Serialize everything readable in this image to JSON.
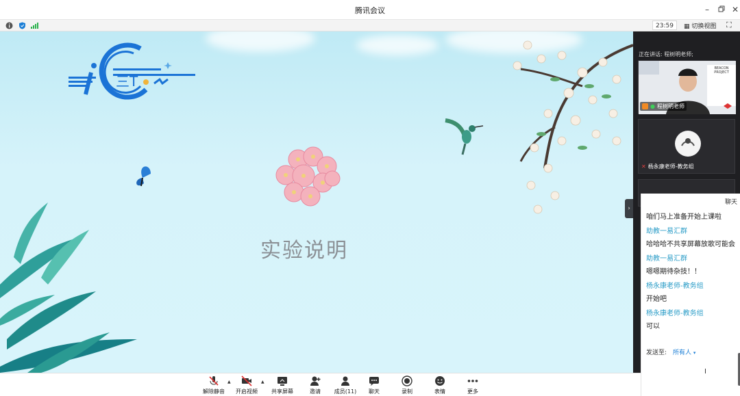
{
  "window": {
    "title": "腾讯会议"
  },
  "status": {
    "clock": "23:59",
    "switch_view": "切换视图"
  },
  "slide": {
    "title": "实验说明",
    "logo_text": "iCTC"
  },
  "participants": {
    "speaking_label": "正在讲话: 程树明老师;",
    "tiles": [
      {
        "name": "程树明老师",
        "poster_text": "BEACON PROJECT"
      },
      {
        "name": "杨永康老师-教务组"
      }
    ]
  },
  "chat": {
    "title": "聊天",
    "messages": [
      {
        "sender": "",
        "text": "咱们马上准备开始上课啦"
      },
      {
        "sender": "助教一易汇群",
        "text": "哈哈哈不共享屏幕放歌可能会"
      },
      {
        "sender": "助教一易汇群",
        "text": "嗯嗯期待杂技！！"
      },
      {
        "sender": "杨永康老师-教务组",
        "text": "开始吧"
      },
      {
        "sender": "杨永康老师-教务组",
        "text": "可以"
      }
    ],
    "send_to_label": "发送至:",
    "send_to_value": "所有人",
    "send_to_caret": "▾"
  },
  "toolbar": {
    "buttons": [
      {
        "label": "解除静音",
        "icon": "mic-muted-icon"
      },
      {
        "label": "开启视频",
        "icon": "video-off-icon"
      },
      {
        "label": "共享屏幕",
        "icon": "share-screen-icon"
      },
      {
        "label": "邀请",
        "icon": "invite-icon"
      },
      {
        "label": "成员(11)",
        "icon": "members-icon"
      },
      {
        "label": "聊天",
        "icon": "chat-icon"
      },
      {
        "label": "录制",
        "icon": "record-icon"
      },
      {
        "label": "表情",
        "icon": "emoji-icon"
      },
      {
        "label": "更多",
        "icon": "more-icon"
      }
    ]
  },
  "colors": {
    "accent": "#1b7ed6",
    "chat_sender": "#2a9cc7",
    "panel_bg": "#1f1f22",
    "stage_bg": "#cdeff8"
  }
}
